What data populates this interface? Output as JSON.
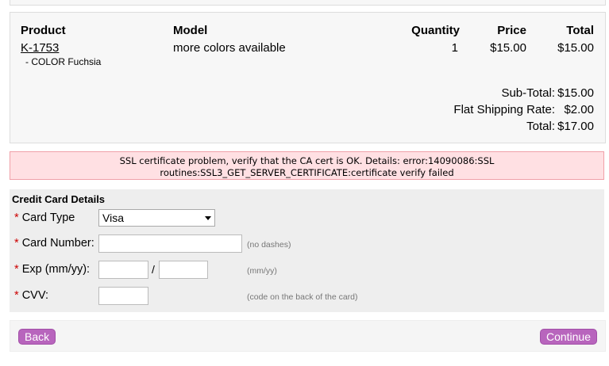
{
  "cart": {
    "headers": {
      "product": "Product",
      "model": "Model",
      "quantity": "Quantity",
      "price": "Price",
      "total": "Total"
    },
    "items": [
      {
        "product": "K-1753",
        "option": "- COLOR Fuchsia",
        "model": "more colors available",
        "quantity": "1",
        "price": "$15.00",
        "total": "$15.00"
      }
    ],
    "totals": {
      "subtotal_label": "Sub-Total:",
      "subtotal_value": "$15.00",
      "shipping_label": "Flat Shipping Rate:",
      "shipping_value": "$2.00",
      "total_label": "Total:",
      "total_value": "$17.00"
    }
  },
  "error": {
    "line1": "SSL certificate problem, verify that the CA cert is OK. Details: error:14090086:SSL",
    "line2": "routines:SSL3_GET_SERVER_CERTIFICATE:certificate verify failed"
  },
  "credit_card": {
    "title": "Credit Card Details",
    "required_mark": "*",
    "card_type_label": "Card Type",
    "card_type_value": "Visa",
    "card_number_label": "Card Number:",
    "card_number_hint": "(no dashes)",
    "exp_label": "Exp (mm/yy):",
    "exp_separator": "/",
    "exp_hint": "(mm/yy)",
    "cvv_label": "CVV:",
    "cvv_hint": "(code on the back of the card)"
  },
  "buttons": {
    "back": "Back",
    "continue": "Continue"
  },
  "colors": {
    "button_bg": "#b865bd",
    "error_bg": "#ffe0e3",
    "required": "#cc0000"
  }
}
